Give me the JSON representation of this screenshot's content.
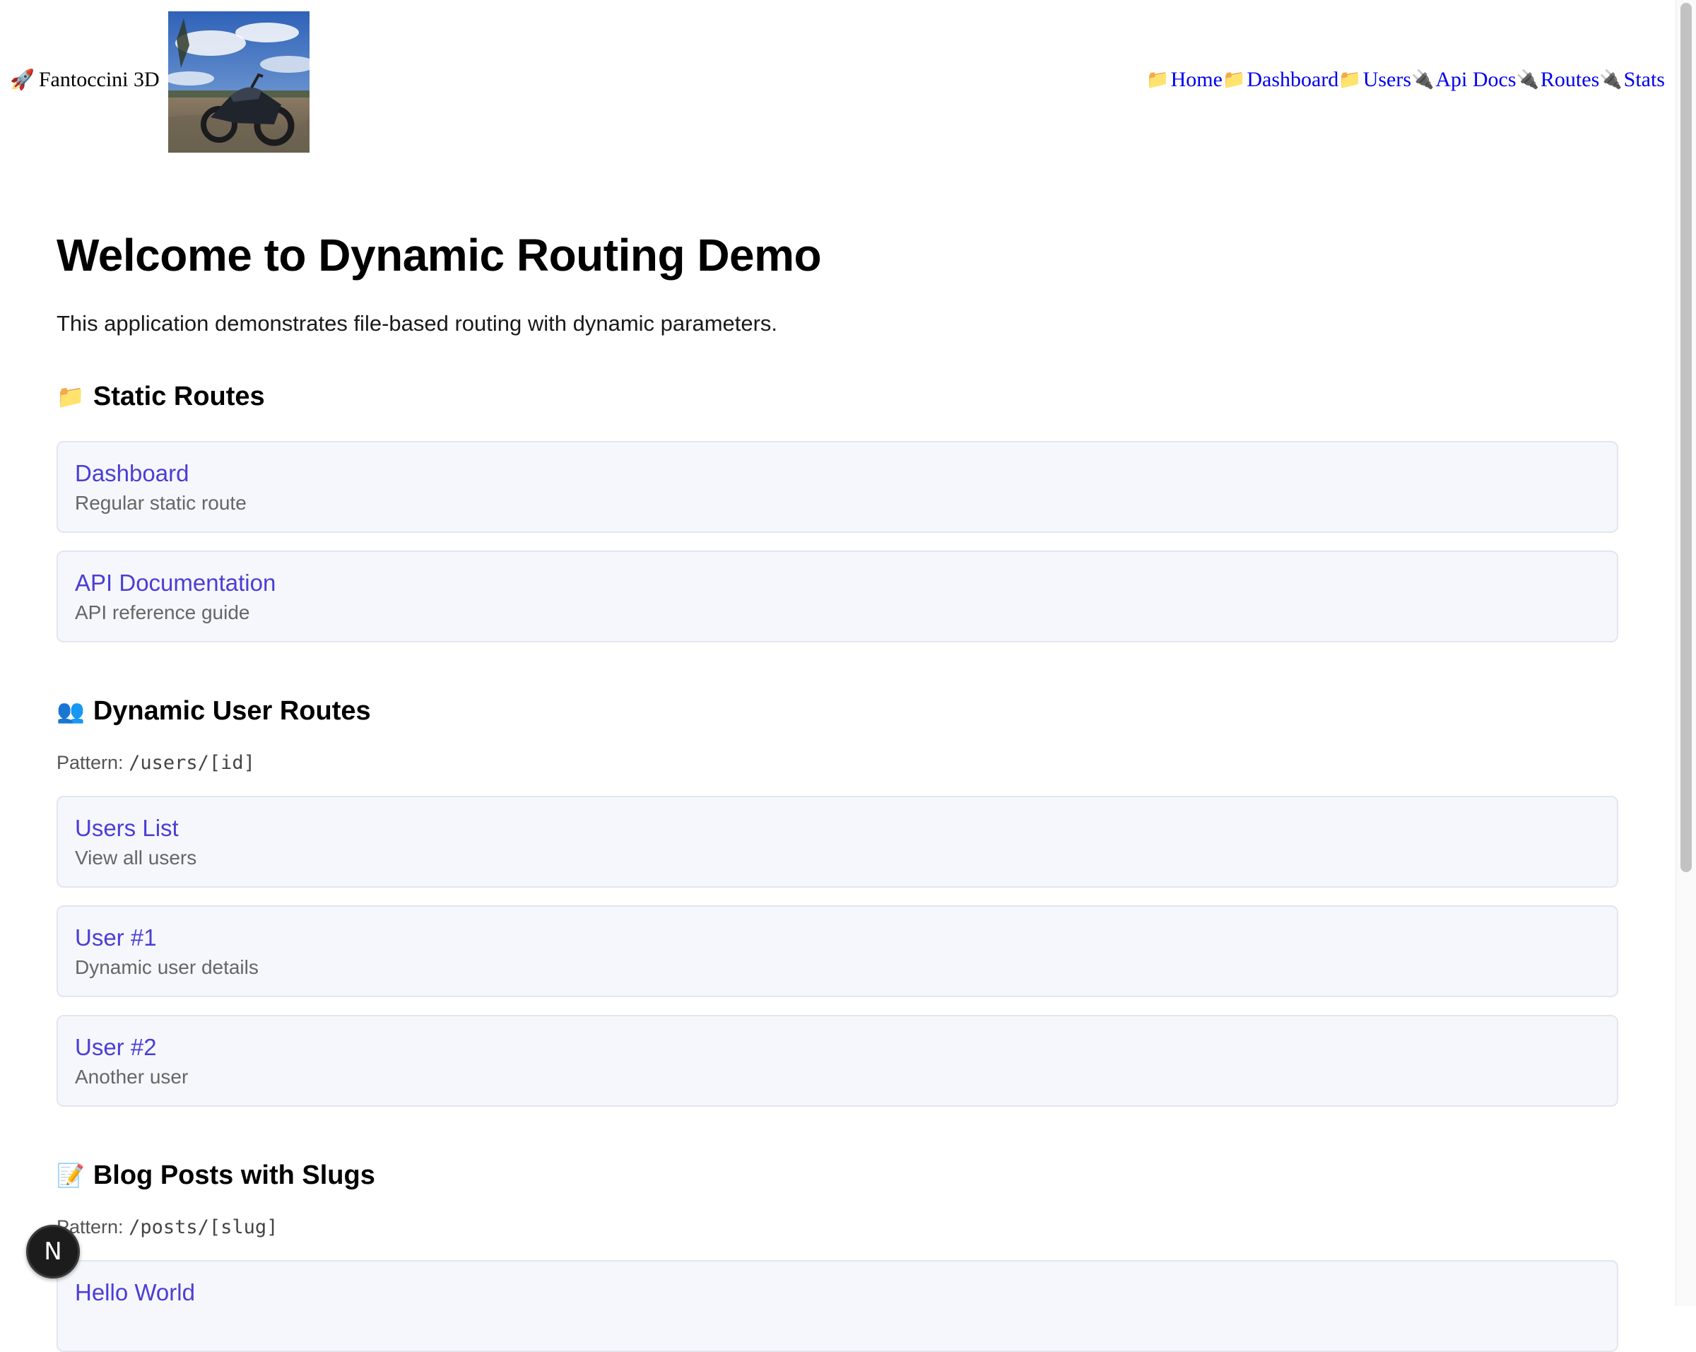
{
  "header": {
    "brand": "Fantoccini 3D",
    "brand_icon": "rocket-icon",
    "nav": [
      {
        "icon": "📁",
        "label": "Home"
      },
      {
        "icon": "📁",
        "label": "Dashboard"
      },
      {
        "icon": "📁",
        "label": "Users"
      },
      {
        "icon": "🔌",
        "label": "Api Docs"
      },
      {
        "icon": "🔌",
        "label": "Routes"
      },
      {
        "icon": "🔌",
        "label": "Stats"
      }
    ]
  },
  "page": {
    "title": "Welcome to Dynamic Routing Demo",
    "lead": "This application demonstrates file-based routing with dynamic parameters."
  },
  "sections": {
    "static": {
      "emoji": "📁",
      "heading": "Static Routes",
      "cards": [
        {
          "title": "Dashboard",
          "desc": "Regular static route"
        },
        {
          "title": "API Documentation",
          "desc": "API reference guide"
        }
      ]
    },
    "users": {
      "emoji": "👥",
      "heading": "Dynamic User Routes",
      "pattern_label": "Pattern: ",
      "pattern_code": "/users/[id]",
      "cards": [
        {
          "title": "Users List",
          "desc": "View all users"
        },
        {
          "title": "User #1",
          "desc": "Dynamic user details"
        },
        {
          "title": "User #2",
          "desc": "Another user"
        }
      ]
    },
    "blog": {
      "emoji": "📝",
      "heading": "Blog Posts with Slugs",
      "pattern_label": "Pattern: ",
      "pattern_code": "/posts/[slug]",
      "cards": [
        {
          "title": "Hello World",
          "desc": ""
        }
      ]
    }
  },
  "fab": {
    "label": "N"
  },
  "colors": {
    "link": "#0000ee",
    "card_title": "#4a3ed6",
    "card_bg": "#f6f7fc",
    "card_border": "#e3e6f0"
  }
}
